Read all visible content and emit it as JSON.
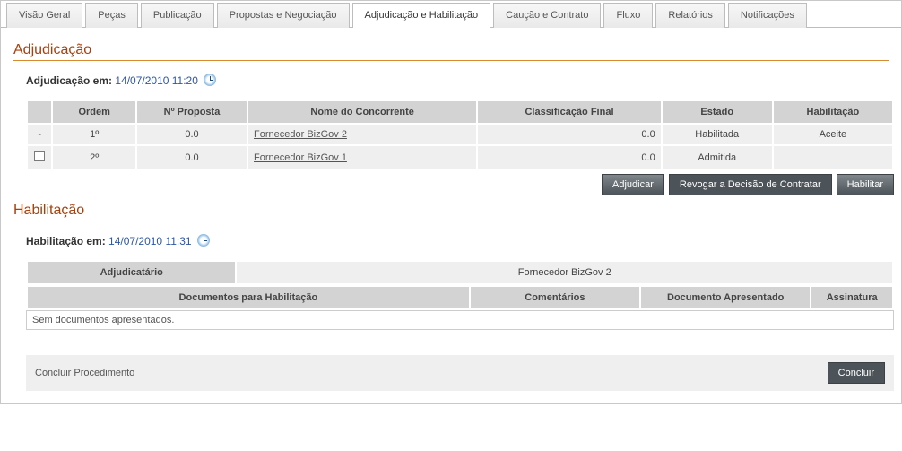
{
  "tabs": [
    {
      "label": "Visão Geral",
      "active": false
    },
    {
      "label": "Peças",
      "active": false
    },
    {
      "label": "Publicação",
      "active": false
    },
    {
      "label": "Propostas e Negociação",
      "active": false
    },
    {
      "label": "Adjudicação e Habilitação",
      "active": true
    },
    {
      "label": "Caução e Contrato",
      "active": false
    },
    {
      "label": "Fluxo",
      "active": false
    },
    {
      "label": "Relatórios",
      "active": false
    },
    {
      "label": "Notificações",
      "active": false
    }
  ],
  "adjudicacao": {
    "title": "Adjudicação",
    "meta_label": "Adjudicação em:",
    "meta_value": "14/07/2010 11:20",
    "columns": {
      "sel": "",
      "ordem": "Ordem",
      "proposta": "Nº Proposta",
      "nome": "Nome do Concorrente",
      "classificacao": "Classificação Final",
      "estado": "Estado",
      "habilitacao": "Habilitação"
    },
    "rows": [
      {
        "sel": "-",
        "ordem": "1º",
        "proposta": "0.0",
        "nome": "Fornecedor BizGov 2",
        "classificacao": "0.0",
        "estado": "Habilitada",
        "habilitacao": "Aceite",
        "checkbox": false
      },
      {
        "sel": "",
        "ordem": "2º",
        "proposta": "0.0",
        "nome": "Fornecedor BizGov 1",
        "classificacao": "0.0",
        "estado": "Admitida",
        "habilitacao": "",
        "checkbox": true
      }
    ],
    "actions": {
      "adjudicar": "Adjudicar",
      "revogar": "Revogar a Decisão de Contratar",
      "habilitar": "Habilitar"
    }
  },
  "habilitacao": {
    "title": "Habilitação",
    "meta_label": "Habilitação em:",
    "meta_value": "14/07/2010 11:31",
    "header1": {
      "adjudicatario": "Adjudicatário",
      "fornecedor": "Fornecedor BizGov 2"
    },
    "header2": {
      "docs": "Documentos para Habilitação",
      "comentarios": "Comentários",
      "apresentado": "Documento Apresentado",
      "assinatura": "Assinatura"
    },
    "nodocs": "Sem documentos apresentados."
  },
  "footer": {
    "label": "Concluir Procedimento",
    "button": "Concluir"
  }
}
